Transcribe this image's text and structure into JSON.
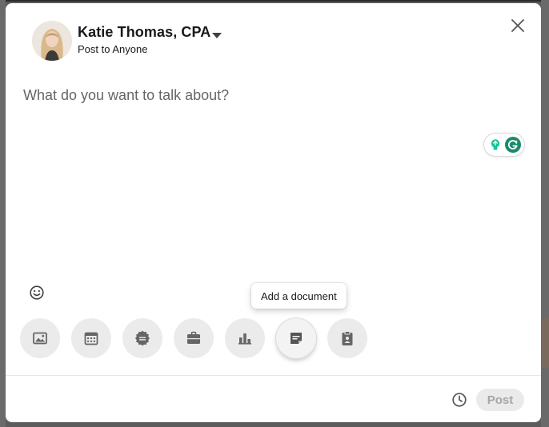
{
  "author": {
    "name": "Katie Thomas, CPA",
    "visibility": "Post to Anyone"
  },
  "editor": {
    "placeholder": "What do you want to talk about?"
  },
  "tooltip": {
    "text": "Add a document"
  },
  "toolbar": {
    "tools": [
      {
        "icon": "photo-icon",
        "active": false
      },
      {
        "icon": "calendar-icon",
        "active": false
      },
      {
        "icon": "celebrate-badge-icon",
        "active": false
      },
      {
        "icon": "briefcase-icon",
        "active": false
      },
      {
        "icon": "poll-icon",
        "active": false
      },
      {
        "icon": "document-icon",
        "active": true
      },
      {
        "icon": "clipboard-icon",
        "active": false
      }
    ]
  },
  "footer": {
    "post_label": "Post"
  },
  "colors": {
    "grammarly_green": "#15c39a",
    "grammarly_dark": "#1b8a6b",
    "icon_gray": "#666666",
    "post_disabled_bg": "#eaeaea",
    "post_disabled_text": "#a6a6a6"
  }
}
